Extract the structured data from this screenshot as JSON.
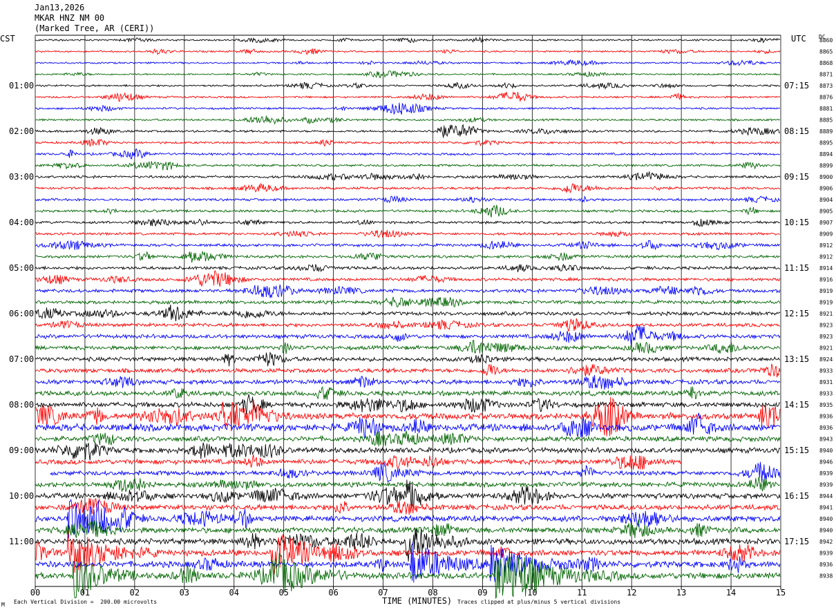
{
  "header": {
    "date": "Jan13,2026",
    "station": "MKAR HNZ NM 00",
    "location": "(Marked Tree, AR (CERI))"
  },
  "axes": {
    "left_tz": "CST",
    "right_tz": "UTC",
    "dc_label": "DC",
    "xlabel": "TIME (MINUTES)",
    "x_ticks": [
      "00",
      "01",
      "02",
      "03",
      "04",
      "05",
      "06",
      "07",
      "08",
      "09",
      "10",
      "11",
      "12",
      "13",
      "14",
      "15"
    ]
  },
  "footer": {
    "scale_note": "Each Vertical Division =  200.00 microvolts",
    "clip_note": "Traces clipped at plus/minus 5 vertical divisions",
    "corner_mark": "M"
  },
  "colors": {
    "cycle": [
      "#000000",
      "#ff0000",
      "#0000ff",
      "#006400"
    ],
    "grid": "#000000"
  },
  "chart_data": {
    "type": "helicorder",
    "title": "",
    "minutes_per_line": 15,
    "xlim": [
      0,
      15
    ],
    "line_count": 48,
    "lines_per_hour": 4,
    "left_hour_labels": [
      "01:00",
      "02:00",
      "03:00",
      "04:00",
      "05:00",
      "06:00",
      "07:00",
      "08:00",
      "09:00",
      "10:00",
      "11:00"
    ],
    "right_hour_labels": [
      "07:15",
      "08:15",
      "09:15",
      "10:15",
      "11:15",
      "12:15",
      "13:15",
      "14:15",
      "15:15",
      "16:15",
      "17:15"
    ],
    "dc_offsets": [
      "8860",
      "8865",
      "8868",
      "8871",
      "8873",
      "8876",
      "8881",
      "8885",
      "8889",
      "8895",
      "8894",
      "8899",
      "8900",
      "8906",
      "8904",
      "8905",
      "8907",
      "8909",
      "8912",
      "8912",
      "8914",
      "8916",
      "8919",
      "8919",
      "8921",
      "8923",
      "8923",
      "8921",
      "8924",
      "8933",
      "8931",
      "8933",
      "8935",
      "8936",
      "8936",
      "8943",
      "8940",
      "8946",
      "8939",
      "8939",
      "8944",
      "8941",
      "8940",
      "8940",
      "8942",
      "8939",
      "8936",
      "8938"
    ],
    "noise_amplitude_px": [
      1.2,
      1.2,
      1.2,
      1.2,
      1.4,
      1.4,
      1.4,
      1.4,
      1.6,
      1.6,
      1.6,
      1.6,
      1.8,
      1.8,
      1.8,
      1.8,
      1.8,
      1.8,
      2.0,
      2.0,
      2.2,
      2.2,
      2.4,
      2.4,
      2.6,
      2.6,
      2.8,
      2.8,
      3.0,
      3.0,
      3.2,
      3.4,
      3.6,
      4.6,
      5.2,
      3.6,
      3.8,
      3.6,
      3.2,
      3.4,
      3.8,
      3.8,
      4.0,
      4.0,
      4.2,
      4.2,
      4.4,
      4.6
    ],
    "events": [
      {
        "line": 8,
        "minute": 8.1,
        "amp_px": 9,
        "dur_min": 0.3
      },
      {
        "line": 16,
        "minute": 13.3,
        "amp_px": 6,
        "dur_min": 0.3
      },
      {
        "line": 33,
        "minute": 3.8,
        "amp_px": 14,
        "dur_min": 0.5
      },
      {
        "line": 33,
        "minute": 4.4,
        "amp_px": 12,
        "dur_min": 0.3
      },
      {
        "line": 33,
        "minute": 14.6,
        "amp_px": 14,
        "dur_min": 0.8
      },
      {
        "line": 40,
        "minute": 7.5,
        "amp_px": 22,
        "dur_min": 0.3
      },
      {
        "line": 42,
        "minute": 0.7,
        "amp_px": 28,
        "dur_min": 0.6
      },
      {
        "line": 44,
        "minute": 7.5,
        "amp_px": 30,
        "dur_min": 0.5
      },
      {
        "line": 45,
        "minute": 0.7,
        "amp_px": 32,
        "dur_min": 0.7
      },
      {
        "line": 45,
        "minute": 4.8,
        "amp_px": 30,
        "dur_min": 0.7
      },
      {
        "line": 46,
        "minute": 7.6,
        "amp_px": 32,
        "dur_min": 0.6
      },
      {
        "line": 46,
        "minute": 9.2,
        "amp_px": 28,
        "dur_min": 0.7
      },
      {
        "line": 47,
        "minute": 0.8,
        "amp_px": 32,
        "dur_min": 0.5
      },
      {
        "line": 47,
        "minute": 4.8,
        "amp_px": 32,
        "dur_min": 0.6
      },
      {
        "line": 47,
        "minute": 9.3,
        "amp_px": 32,
        "dur_min": 1.0
      }
    ],
    "gaps": [
      {
        "line": 37,
        "from_minute": 13.0,
        "to_minute": 15.0
      },
      {
        "line": 38,
        "from_minute": 0.0,
        "to_minute": 0.3
      }
    ]
  }
}
